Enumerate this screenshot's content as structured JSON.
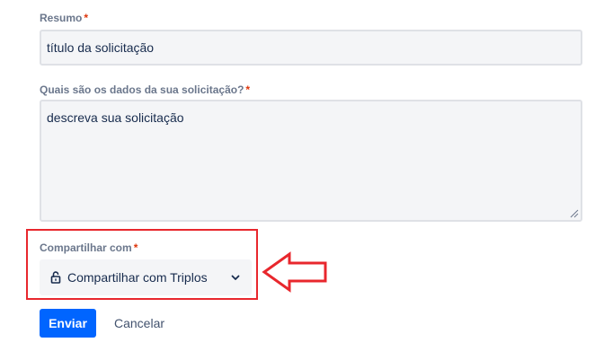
{
  "form": {
    "summary": {
      "label": "Resumo",
      "required_mark": "*",
      "value": "título da solicitação"
    },
    "details": {
      "label": "Quais são os dados da sua solicitação?",
      "required_mark": "*",
      "value": "descreva sua solicitação"
    },
    "share": {
      "label": "Compartilhar com",
      "required_mark": "*",
      "selected": "Compartilhar com Triplos",
      "icon": "lock-open-icon"
    },
    "actions": {
      "submit_label": "Enviar",
      "cancel_label": "Cancelar"
    }
  },
  "annotation": {
    "highlight_color": "#e8272d",
    "arrow_direction": "left"
  },
  "colors": {
    "primary": "#0065ff",
    "required": "#de350b",
    "field_bg": "#f4f5f7"
  }
}
